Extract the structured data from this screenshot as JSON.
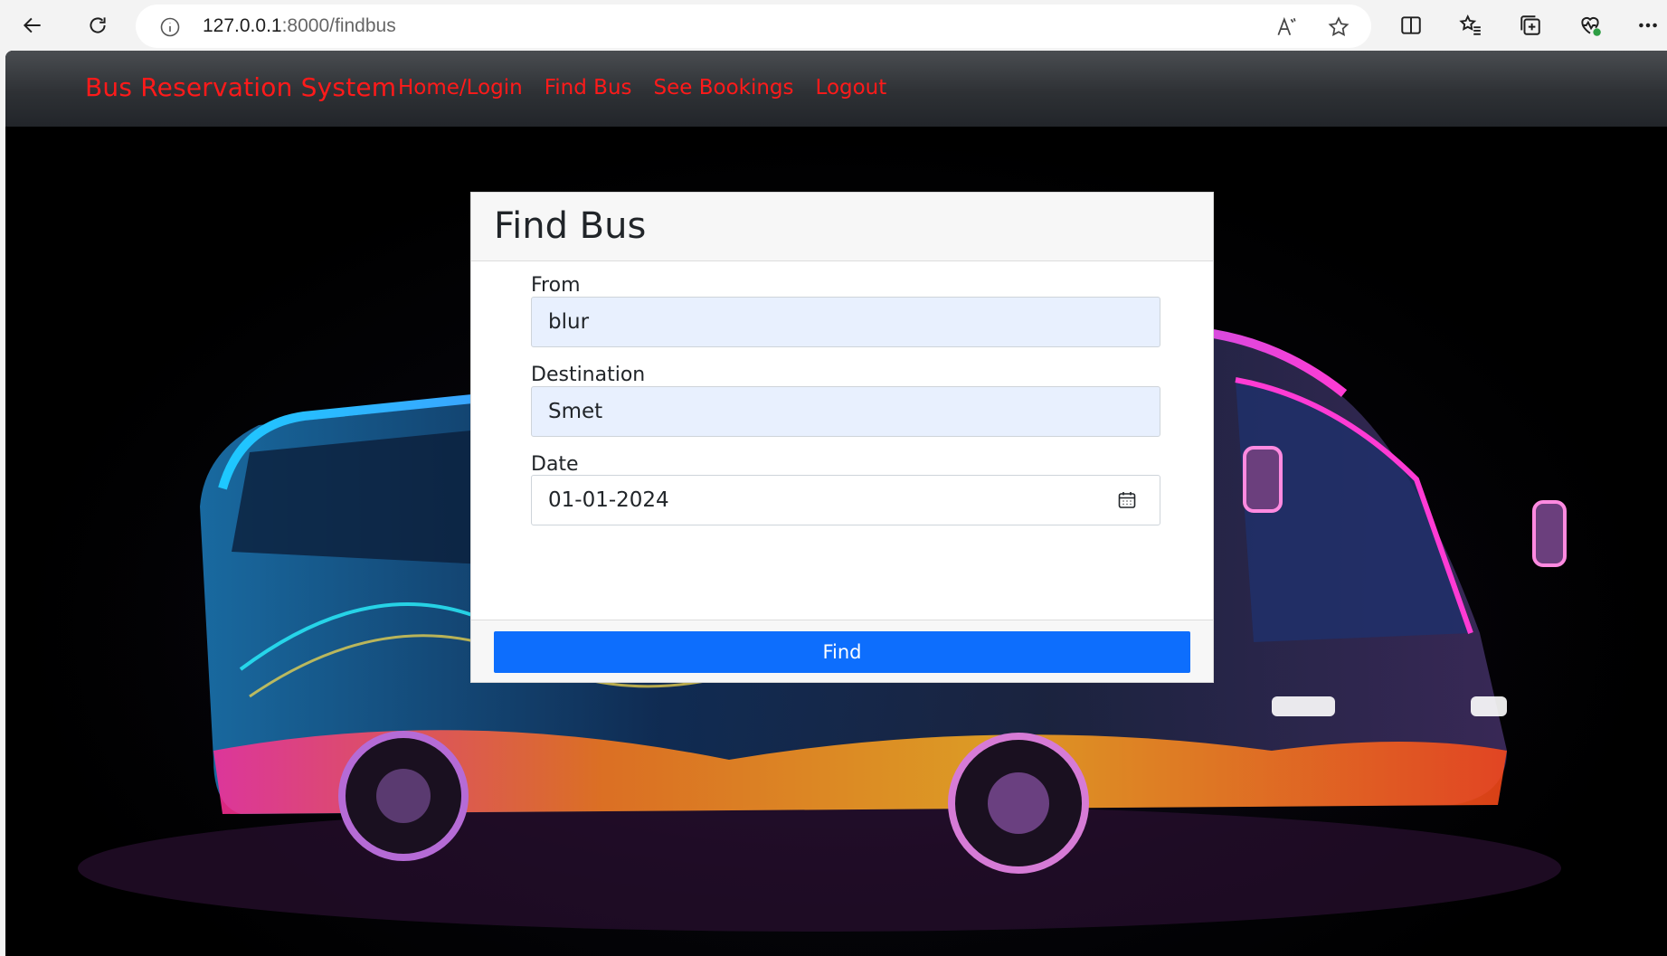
{
  "browser": {
    "url_host": "127.0.0.1",
    "url_path": ":8000/findbus",
    "read_aloud_label": "Ȃ"
  },
  "navbar": {
    "brand": "Bus Reservation System",
    "links": [
      {
        "label": "Home/Login"
      },
      {
        "label": "Find Bus"
      },
      {
        "label": "See Bookings"
      },
      {
        "label": "Logout"
      }
    ],
    "link_color": "#ff1a1a"
  },
  "card": {
    "title": "Find Bus",
    "fields": {
      "from": {
        "label": "From",
        "value": "blur"
      },
      "destination": {
        "label": "Destination",
        "value": "Smet"
      },
      "date": {
        "label": "Date",
        "value": "01-01-2024"
      }
    },
    "submit_label": "Find",
    "button_color": "#0d6efd"
  }
}
